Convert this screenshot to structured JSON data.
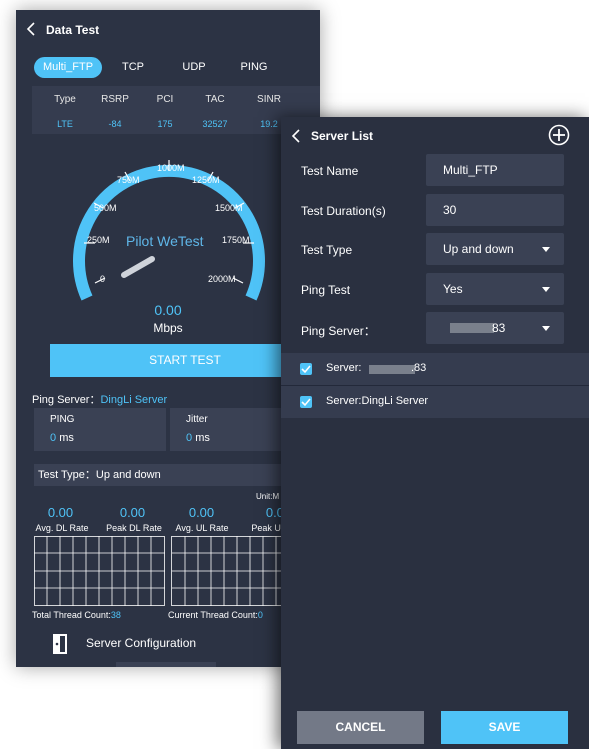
{
  "back": {
    "title": "Data Test",
    "tabs": [
      "Multi_FTP",
      "TCP",
      "UDP",
      "PING"
    ],
    "columns": [
      "Type",
      "RSRP",
      "PCI",
      "TAC",
      "SINR"
    ],
    "values": [
      "LTE",
      "-84",
      "175",
      "32527",
      "19.2"
    ],
    "gauge_ticks": [
      "0",
      "250M",
      "500M",
      "750M",
      "1000M",
      "1250M",
      "1500M",
      "1750M",
      "2000M"
    ],
    "watermark": "Pilot WeTest",
    "speed_value": "0.00",
    "speed_unit": "Mbps",
    "start_button": "START TEST",
    "ping_server_label": "Ping Server：",
    "ping_server_value": "DingLi Server",
    "ping_label": "PING",
    "ping_value": "0",
    "ping_unit": "ms",
    "jitter_label": "Jitter",
    "jitter_value": "0",
    "jitter_unit": "ms",
    "test_type": "Test Type：Up and down",
    "unit_label": "Unit:M",
    "rates": [
      {
        "value": "0.00",
        "label": "Avg. DL Rate"
      },
      {
        "value": "0.00",
        "label": "Peak DL Rate"
      },
      {
        "value": "0.00",
        "label": "Avg. UL Rate"
      },
      {
        "value": "0.00",
        "label": "Peak UL R"
      }
    ],
    "total_thread_label": "Total Thread Count:",
    "total_thread_value": "38",
    "current_thread_label": "Current Thread Count:",
    "current_thread_value": "0",
    "server_config": "Server Configuration"
  },
  "front": {
    "title": "Server List",
    "fields": [
      {
        "label": "Test Name",
        "value": "Multi_FTP",
        "dropdown": false
      },
      {
        "label": "Test Duration(s)",
        "value": "30",
        "dropdown": false
      },
      {
        "label": "Test Type",
        "value": "Up and down",
        "dropdown": true
      },
      {
        "label": "Ping Test",
        "value": "Yes",
        "dropdown": true
      },
      {
        "label": "Ping Server：",
        "value": "83",
        "dropdown": true
      }
    ],
    "servers": [
      "Server:",
      "Server:DingLi Server"
    ],
    "server1_suffix": ".83",
    "cancel": "CANCEL",
    "save": "SAVE"
  },
  "colors": {
    "accent": "#4fc3f7",
    "panel": "#2c3344",
    "field": "#3a4154"
  }
}
